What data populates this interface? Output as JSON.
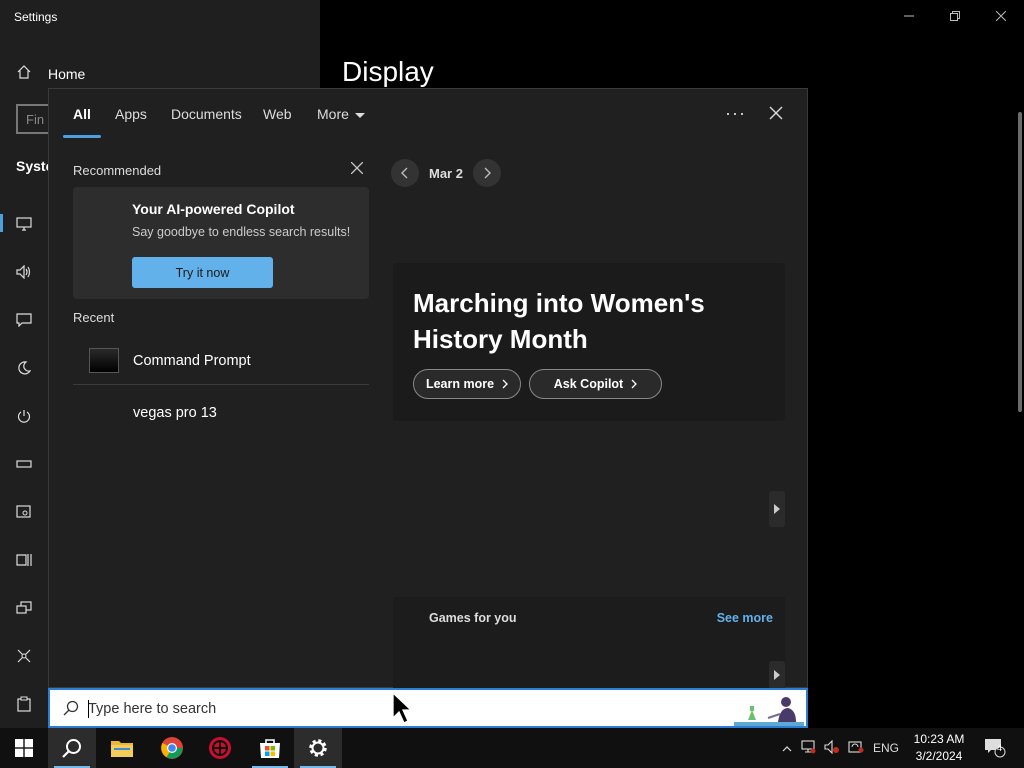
{
  "settings": {
    "title": "Settings",
    "home_label": "Home",
    "find_placeholder": "Fin",
    "system_label": "Syste",
    "page_title": "Display"
  },
  "search_panel": {
    "tabs": [
      {
        "label": "All",
        "active": true
      },
      {
        "label": "Apps",
        "active": false
      },
      {
        "label": "Documents",
        "active": false
      },
      {
        "label": "Web",
        "active": false
      },
      {
        "label": "More",
        "active": false
      }
    ],
    "recommended": {
      "label": "Recommended",
      "card_title": "Your AI-powered Copilot",
      "card_subtitle": "Say goodbye to endless search results!",
      "button_label": "Try it now"
    },
    "recent": {
      "label": "Recent",
      "items": [
        {
          "label": "Command Prompt",
          "icon": "command-prompt-icon"
        },
        {
          "label": "vegas pro 13",
          "icon": "none"
        }
      ]
    },
    "highlights": {
      "date": "Mar 2",
      "hero_title": "Marching into Women's History Month",
      "learn_more": "Learn more",
      "ask_copilot": "Ask Copilot"
    },
    "games": {
      "label": "Games for you",
      "see_more": "See more"
    }
  },
  "search_box": {
    "placeholder": "Type here to search"
  },
  "taskbar": {
    "apps": [
      "start-icon",
      "search-icon",
      "file-explorer-icon",
      "chrome-icon",
      "app-icon",
      "microsoft-store-icon",
      "settings-icon"
    ],
    "language": "ENG",
    "time": "10:23 AM",
    "date": "3/2/2024",
    "notification_count": "4"
  },
  "colors": {
    "accent": "#4ca0e0",
    "button_blue": "#63b1ea",
    "panel_bg": "#202020"
  }
}
